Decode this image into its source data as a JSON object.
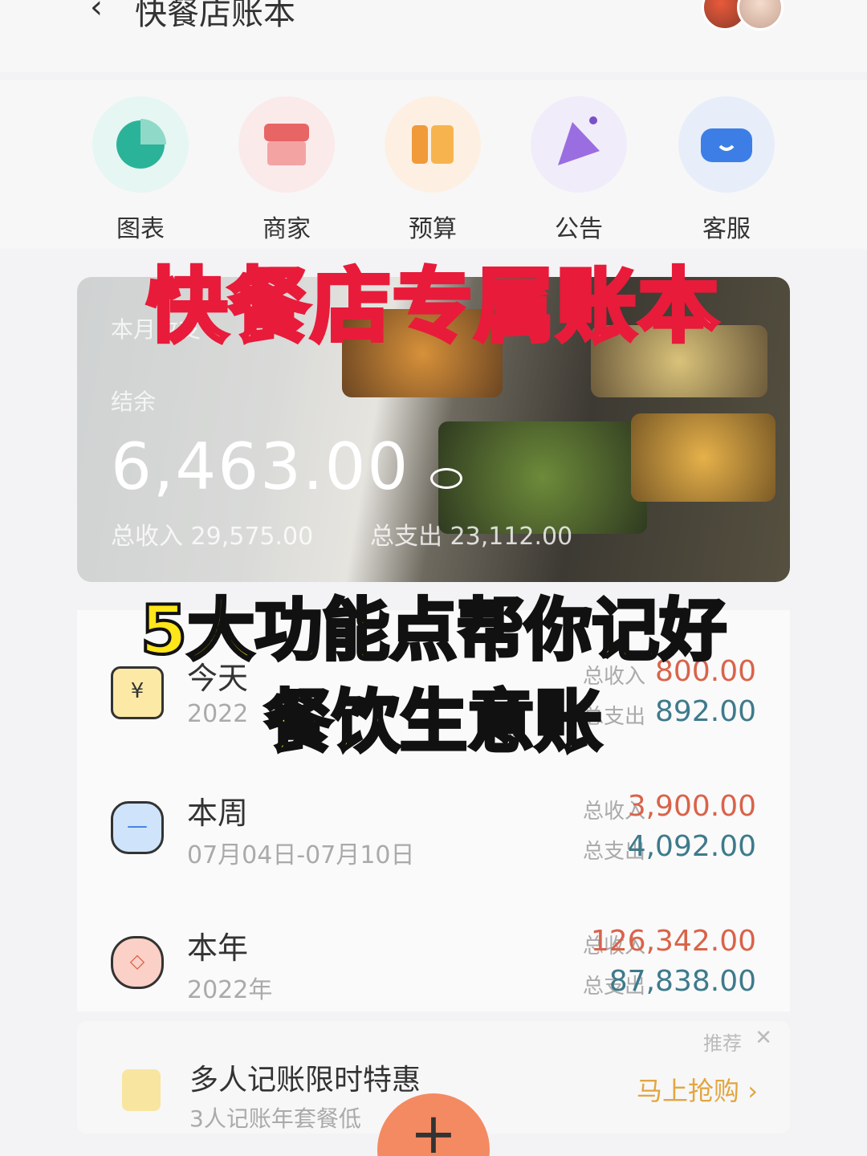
{
  "header": {
    "back_icon": "chevron-left-icon",
    "title": "快餐店账本"
  },
  "icon_menu": [
    {
      "label": "图表",
      "icon": "pie-chart-icon",
      "color": "#2bb39a"
    },
    {
      "label": "商家",
      "icon": "shop-icon",
      "color": "#e86565"
    },
    {
      "label": "预算",
      "icon": "budget-icon",
      "color": "#f09a3a"
    },
    {
      "label": "公告",
      "icon": "megaphone-icon",
      "color": "#9a6ee0"
    },
    {
      "label": "客服",
      "icon": "customer-service-icon",
      "color": "#3d7ee6"
    }
  ],
  "summary": {
    "period_label": "本月收支",
    "balance_label": "结余",
    "balance": "6,463.00",
    "income_label": "总收入",
    "income": "29,575.00",
    "expense_label": "总支出",
    "expense": "23,112.00"
  },
  "periods": [
    {
      "name": "今天",
      "sub": "2022",
      "income_label": "总收入",
      "income": "800.00",
      "expense_label": "总支出",
      "expense": "892.00",
      "icon": "yen-calendar-icon"
    },
    {
      "name": "本周",
      "sub": "07月04日-07月10日",
      "income_label": "总收入",
      "income": "3,900.00",
      "expense_label": "总支出",
      "expense": "4,092.00",
      "icon": "week-calendar-icon"
    },
    {
      "name": "本年",
      "sub": "2022年",
      "income_label": "总收入",
      "income": "126,342.00",
      "expense_label": "总支出",
      "expense": "87,838.00",
      "icon": "lantern-icon"
    }
  ],
  "promo": {
    "tag": "推荐",
    "title": "多人记账限时特惠",
    "subtitle": "3人记账年套餐低",
    "button": "马上抢购"
  },
  "fab": "+",
  "overlay": {
    "headline": "快餐店专属账本",
    "line2": "5大功能点帮你记好",
    "line3": "餐饮生意账"
  }
}
